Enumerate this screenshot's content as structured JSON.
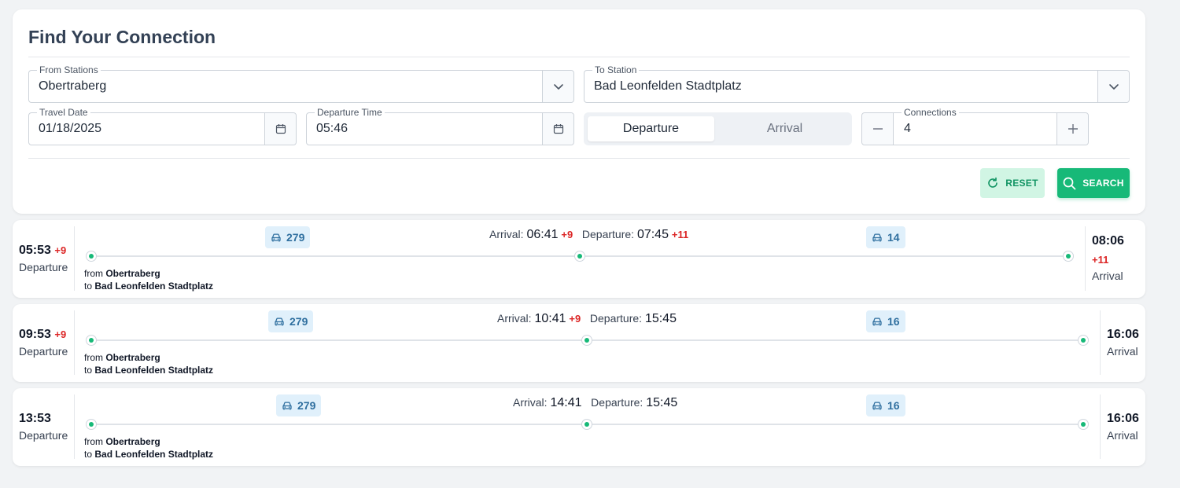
{
  "form": {
    "title": "Find Your Connection",
    "from_label": "From Stations",
    "from_value": "Obertraberg",
    "to_label": "To Station",
    "to_value": "Bad Leonfelden Stadtplatz",
    "date_label": "Travel Date",
    "date_value": "01/18/2025",
    "time_label": "Departure Time",
    "time_value": "05:46",
    "mode_options": [
      "Departure",
      "Arrival"
    ],
    "mode_selected": "Departure",
    "connections_label": "Connections",
    "connections_value": "4",
    "reset_label": "RESET",
    "search_label": "SEARCH"
  },
  "colors": {
    "accent": "#17b978",
    "delay": "#dc2626",
    "badge_bg": "#e0f0fb",
    "badge_text": "#2f6f9f"
  },
  "results": [
    {
      "departure_time": "05:53",
      "departure_delay": "+9",
      "departure_label": "Departure",
      "first_line": "279",
      "transfer_arrival_label": "Arrival:",
      "transfer_arrival": "06:41",
      "transfer_arrival_delay": "+9",
      "transfer_departure_label": "Departure:",
      "transfer_departure": "07:45",
      "transfer_departure_delay": "+11",
      "second_line": "14",
      "from_prefix": "from",
      "from": "Obertraberg",
      "to_prefix": "to",
      "to": "Bad Leonfelden Stadtplatz",
      "arrival_time": "08:06",
      "arrival_delay": "+11",
      "arrival_label": "Arrival"
    },
    {
      "departure_time": "09:53",
      "departure_delay": "+9",
      "departure_label": "Departure",
      "first_line": "279",
      "transfer_arrival_label": "Arrival:",
      "transfer_arrival": "10:41",
      "transfer_arrival_delay": "+9",
      "transfer_departure_label": "Departure:",
      "transfer_departure": "15:45",
      "transfer_departure_delay": "",
      "second_line": "16",
      "from_prefix": "from",
      "from": "Obertraberg",
      "to_prefix": "to",
      "to": "Bad Leonfelden Stadtplatz",
      "arrival_time": "16:06",
      "arrival_delay": "",
      "arrival_label": "Arrival"
    },
    {
      "departure_time": "13:53",
      "departure_delay": "",
      "departure_label": "Departure",
      "first_line": "279",
      "transfer_arrival_label": "Arrival:",
      "transfer_arrival": "14:41",
      "transfer_arrival_delay": "",
      "transfer_departure_label": "Departure:",
      "transfer_departure": "15:45",
      "transfer_departure_delay": "",
      "second_line": "16",
      "from_prefix": "from",
      "from": "Obertraberg",
      "to_prefix": "to",
      "to": "Bad Leonfelden Stadtplatz",
      "arrival_time": "16:06",
      "arrival_delay": "",
      "arrival_label": "Arrival"
    }
  ]
}
